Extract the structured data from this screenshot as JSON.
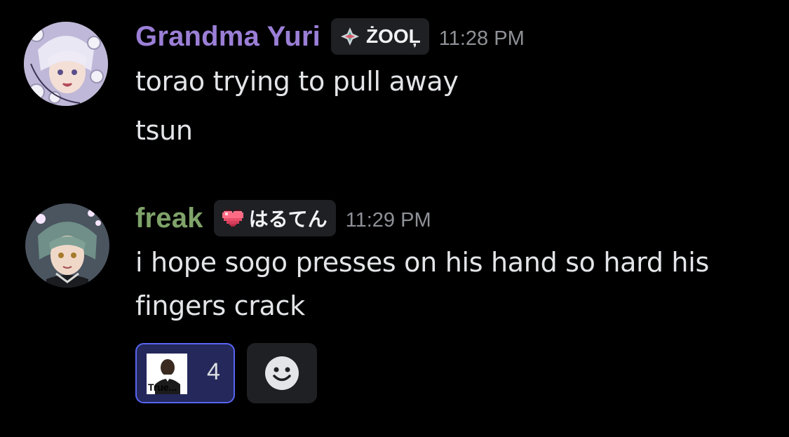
{
  "messages": [
    {
      "username": "Grandma Yuri",
      "username_color": "#9b7fd6",
      "tag": {
        "icon": "diamond-sparkle-icon",
        "label": "ŻOOĻ"
      },
      "timestamp": "11:28 PM",
      "lines": [
        "torao trying to pull away",
        "tsun"
      ]
    },
    {
      "username": "freak",
      "username_color": "#7fa36a",
      "tag": {
        "icon": "pixel-heart-icon",
        "label": "はるてん"
      },
      "timestamp": "11:29 PM",
      "lines": [
        "i hope sogo presses on his hand so hard his",
        "fingers crack"
      ],
      "reactions": [
        {
          "emoji_label": "True...",
          "count": "4",
          "selected": true
        }
      ],
      "add_reaction_icon": "smiley-face-icon"
    }
  ],
  "colors": {
    "background": "#000000",
    "reaction_selected_border": "#5865f2",
    "reaction_selected_bg": "#24285a"
  }
}
